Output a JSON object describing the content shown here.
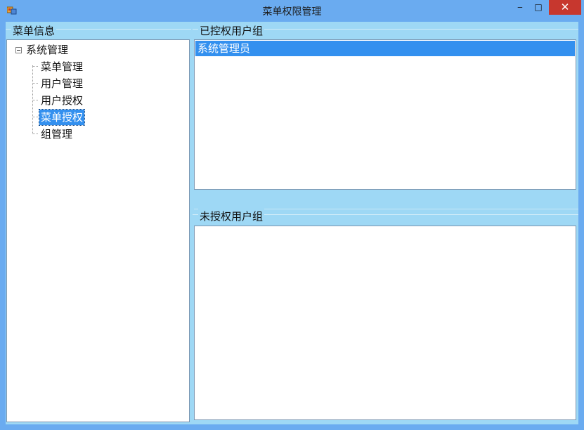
{
  "window": {
    "title": "菜单权限管理",
    "minimize_glyph": "‒",
    "maximize_glyph": "□",
    "close_glyph": "✕"
  },
  "menu_info": {
    "group_title": "菜单信息",
    "tree": {
      "root_label": "系统管理",
      "root_expanded": true,
      "children": [
        {
          "label": "菜单管理",
          "selected": false
        },
        {
          "label": "用户管理",
          "selected": false
        },
        {
          "label": "用户授权",
          "selected": false
        },
        {
          "label": "菜单授权",
          "selected": true
        },
        {
          "label": "组管理",
          "selected": false
        }
      ]
    }
  },
  "authorized_groups": {
    "group_title": "已控权用户组",
    "items": [
      {
        "label": "系统管理员",
        "selected": true
      }
    ]
  },
  "unauthorized_groups": {
    "group_title": "未授权用户组",
    "items": []
  },
  "colors": {
    "selection": "#3390ef",
    "frame": "#6aabf0",
    "client_bg": "#9ed8f5",
    "close_button": "#c7372e"
  }
}
